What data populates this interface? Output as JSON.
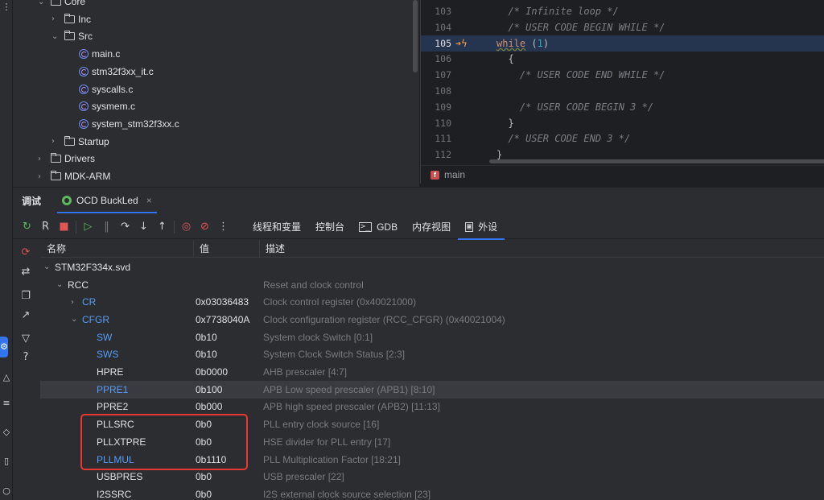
{
  "project_tree": {
    "items": [
      {
        "label": "Core",
        "type": "folder",
        "expanded": true,
        "depth": 3
      },
      {
        "label": "Inc",
        "type": "folder",
        "expanded": false,
        "depth": 4
      },
      {
        "label": "Src",
        "type": "folder",
        "expanded": true,
        "depth": 4
      },
      {
        "label": "main.c",
        "type": "cfile",
        "depth": 5
      },
      {
        "label": "stm32f3xx_it.c",
        "type": "cfile",
        "depth": 5
      },
      {
        "label": "syscalls.c",
        "type": "cfile",
        "depth": 5
      },
      {
        "label": "sysmem.c",
        "type": "cfile",
        "depth": 5
      },
      {
        "label": "system_stm32f3xx.c",
        "type": "cfile",
        "depth": 5
      },
      {
        "label": "Startup",
        "type": "folder",
        "expanded": false,
        "depth": 4
      },
      {
        "label": "Drivers",
        "type": "folder",
        "expanded": false,
        "depth": 3
      },
      {
        "label": "MDK-ARM",
        "type": "folder",
        "expanded": false,
        "depth": 3
      }
    ]
  },
  "editor": {
    "lines": [
      {
        "no": "103",
        "text": "  /* Infinite loop */"
      },
      {
        "no": "104",
        "text": "  /* USER CODE BEGIN WHILE */"
      },
      {
        "no": "105",
        "text": "while (1)",
        "keyword": "while",
        "rest": " (",
        "number": "1",
        "close": ")"
      },
      {
        "no": "106",
        "text": "  {"
      },
      {
        "no": "107",
        "text": "    /* USER CODE END WHILE */"
      },
      {
        "no": "108",
        "text": ""
      },
      {
        "no": "109",
        "text": "    /* USER CODE BEGIN 3 */"
      },
      {
        "no": "110",
        "text": "  }"
      },
      {
        "no": "111",
        "text": "  /* USER CODE END 3 */"
      },
      {
        "no": "112",
        "text": "}"
      }
    ],
    "current_line_marker": "➔ϟ",
    "breadcrumb_label": "main",
    "breadcrumb_icon_glyph": "f"
  },
  "debug": {
    "title": "调试",
    "session_tab": "OCD BuckLed",
    "close_glyph": "×",
    "tabs": [
      {
        "label": "线程和变量"
      },
      {
        "label": "控制台"
      },
      {
        "label": "GDB",
        "glyph": ">_"
      },
      {
        "label": "内存视图"
      },
      {
        "label": "外设",
        "glyph": "▣",
        "active": true
      }
    ],
    "columns": {
      "name": "名称",
      "value": "值",
      "desc": "描述"
    },
    "rows": [
      {
        "name": "STM32F334x.svd",
        "value": "",
        "desc": "",
        "indent": 0,
        "chev": "⌄",
        "color": "white"
      },
      {
        "name": "RCC",
        "value": "",
        "desc": "Reset and clock control",
        "indent": 1,
        "chev": "⌄",
        "color": "white"
      },
      {
        "name": "CR",
        "value": "0x03036483",
        "desc": "Clock control register (0x40021000)",
        "indent": 2,
        "chev": "›",
        "color": "blue"
      },
      {
        "name": "CFGR",
        "value": "0x7738040A",
        "desc": "Clock configuration register (RCC_CFGR) (0x40021004)",
        "indent": 2,
        "chev": "⌄",
        "color": "blue"
      },
      {
        "name": "SW",
        "value": "0b10",
        "desc": "System clock Switch [0:1]",
        "indent": 3,
        "color": "blue"
      },
      {
        "name": "SWS",
        "value": "0b10",
        "desc": "System Clock Switch Status [2:3]",
        "indent": 3,
        "color": "blue"
      },
      {
        "name": "HPRE",
        "value": "0b0000",
        "desc": "AHB prescaler [4:7]",
        "indent": 3,
        "color": "white"
      },
      {
        "name": "PPRE1",
        "value": "0b100",
        "desc": "APB Low speed prescaler (APB1) [8:10]",
        "indent": 3,
        "color": "blue",
        "highlight": true
      },
      {
        "name": "PPRE2",
        "value": "0b000",
        "desc": "APB high speed prescaler (APB2) [11:13]",
        "indent": 3,
        "color": "white"
      },
      {
        "name": "PLLSRC",
        "value": "0b0",
        "desc": "PLL entry clock source [16]",
        "indent": 3,
        "color": "white"
      },
      {
        "name": "PLLXTPRE",
        "value": "0b0",
        "desc": "HSE divider for PLL entry [17]",
        "indent": 3,
        "color": "white"
      },
      {
        "name": "PLLMUL",
        "value": "0b1110",
        "desc": "PLL Multiplication Factor [18:21]",
        "indent": 3,
        "color": "blue"
      },
      {
        "name": "USBPRES",
        "value": "0b0",
        "desc": "USB prescaler [22]",
        "indent": 3,
        "color": "white"
      },
      {
        "name": "I2SSRC",
        "value": "0b0",
        "desc": "I2S external clock source selection [23]",
        "indent": 3,
        "color": "white"
      }
    ]
  },
  "colors": {
    "accent": "#3574f0",
    "annotation": "#e8382f",
    "register_link": "#589df6"
  }
}
